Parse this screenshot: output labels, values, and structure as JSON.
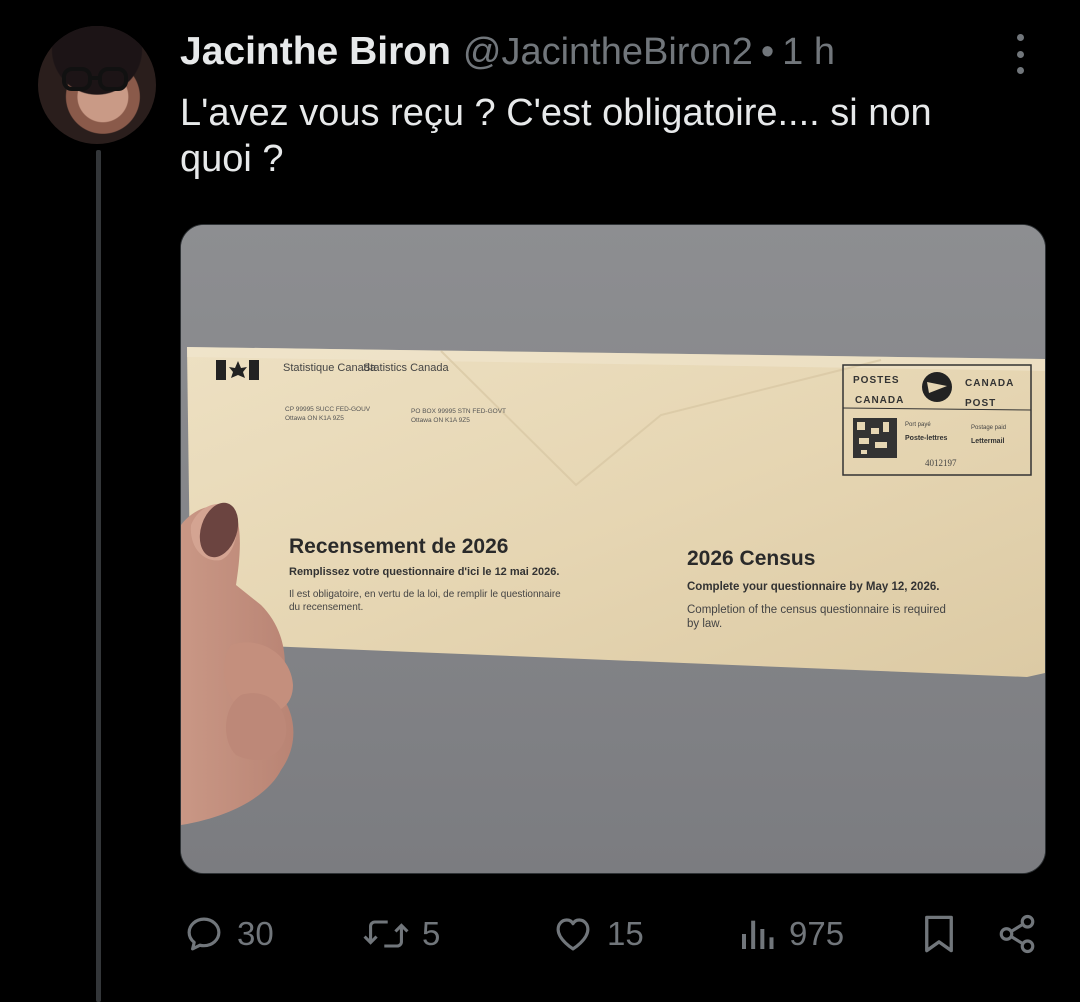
{
  "tweet": {
    "author_name": "Jacinthe Biron",
    "author_handle": "@JacintheBiron2",
    "separator": "•",
    "time": "1 h",
    "text": "L'avez vous reçu ? C'est obligatoire.... si non quoi ?"
  },
  "envelope": {
    "sender_fr": "Statistique Canada",
    "sender_en": "Statistics Canada",
    "addr_fr_1": "CP 99995 SUCC FED-GOUV",
    "addr_fr_2": "Ottawa ON K1A 9Z5",
    "addr_en_1": "PO BOX 99995 STN FED-GOVT",
    "addr_en_2": "Ottawa ON K1A 9Z5",
    "postage": {
      "postes": "POSTES",
      "canada_left": "CANADA",
      "canada_right": "CANADA",
      "post": "POST",
      "port_paye": "Port payé",
      "postage_paid": "Postage paid",
      "poste_lettres": "Poste-lettres",
      "lettermail": "Lettermail",
      "number": "4012197"
    },
    "title_fr": "Recensement de 2026",
    "deadline_fr": "Remplissez votre questionnaire d'ici le 12 mai 2026.",
    "law_fr": "Il est obligatoire, en vertu de la loi, de remplir le questionnaire du recensement.",
    "title_en": "2026 Census",
    "deadline_en": "Complete your questionnaire by May 12, 2026.",
    "law_en": "Completion of the census questionnaire is required by law."
  },
  "actions": {
    "replies": "30",
    "reposts": "5",
    "likes": "15",
    "views": "975"
  },
  "colors": {
    "background": "#000000",
    "text": "#e7e9ea",
    "muted": "#71767b",
    "envelope": "#e8d9b8"
  }
}
